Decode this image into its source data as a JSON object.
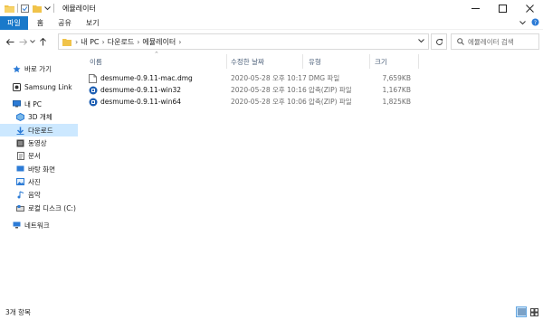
{
  "window": {
    "title": "에뮬레이터"
  },
  "ribbon": {
    "tabs": [
      "파일",
      "홈",
      "공유",
      "보기"
    ]
  },
  "address": {
    "breadcrumbs": [
      "내 PC",
      "다운로드",
      "에뮬레이터"
    ]
  },
  "search": {
    "placeholder": "에뮬레이터 검색"
  },
  "nav": {
    "items": [
      {
        "label": "바로 가기",
        "icon": "star-icon"
      },
      {
        "label": "Samsung Link",
        "icon": "samsung-link-icon"
      },
      {
        "label": "내 PC",
        "icon": "pc-icon"
      },
      {
        "label": "3D 개체",
        "icon": "3d-objects-icon"
      },
      {
        "label": "다운로드",
        "icon": "download-icon"
      },
      {
        "label": "동영상",
        "icon": "video-icon"
      },
      {
        "label": "문서",
        "icon": "document-icon"
      },
      {
        "label": "바탕 화면",
        "icon": "desktop-icon"
      },
      {
        "label": "사진",
        "icon": "pictures-icon"
      },
      {
        "label": "음악",
        "icon": "music-icon"
      },
      {
        "label": "로컬 디스크 (C:)",
        "icon": "drive-icon"
      },
      {
        "label": "네트워크",
        "icon": "network-icon"
      }
    ]
  },
  "columns": {
    "name": "이름",
    "date": "수정한 날짜",
    "type": "유형",
    "size": "크기"
  },
  "files": [
    {
      "name": "desmume-0.9.11-mac.dmg",
      "date": "2020-05-28 오후 10:17",
      "type": "DMG 파일",
      "size": "7,659KB",
      "icon": "dmg-file-icon"
    },
    {
      "name": "desmume-0.9.11-win32",
      "date": "2020-05-28 오후 10:16",
      "type": "압축(ZIP) 파일",
      "size": "1,167KB",
      "icon": "zip-file-icon"
    },
    {
      "name": "desmume-0.9.11-win64",
      "date": "2020-05-28 오후 10:06",
      "type": "압축(ZIP) 파일",
      "size": "1,825KB",
      "icon": "zip-file-icon"
    }
  ],
  "status": {
    "count": "3개 항목"
  },
  "colors": {
    "accent": "#1979ca",
    "selected": "#cce8ff"
  }
}
